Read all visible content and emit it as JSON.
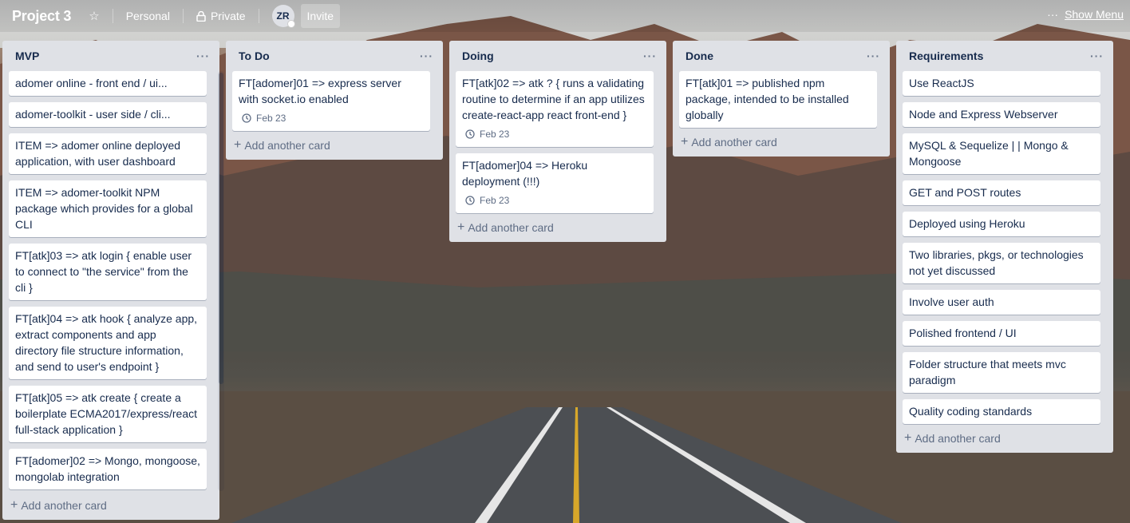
{
  "header": {
    "board_title": "Project 3",
    "star_icon": "star-icon",
    "team_label": "Personal",
    "visibility_label": "Private",
    "member_initials": "ZR",
    "invite_label": "Invite",
    "show_menu_label": "Show Menu"
  },
  "lists": [
    {
      "title": "MVP",
      "cards": [
        {
          "text": "adomer online - front end / ui..."
        },
        {
          "text": "adomer-toolkit - user side / cli..."
        },
        {
          "text": "ITEM => adomer online deployed application, with user dashboard"
        },
        {
          "text": "ITEM => adomer-toolkit NPM package which provides for a global CLI"
        },
        {
          "text": "FT[atk]03 => atk login { enable user to connect to \"the service\" from the cli }"
        },
        {
          "text": "FT[atk]04 => atk hook { analyze app, extract components and app directory file structure information, and send to user's endpoint }"
        },
        {
          "text": "FT[atk]05 => atk create { create a boilerplate ECMA2017/express/react full-stack application }"
        },
        {
          "text": "FT[adomer]02 => Mongo, mongoose, mongolab integration"
        }
      ],
      "add_label": "Add another card"
    },
    {
      "title": "To Do",
      "cards": [
        {
          "text": "FT[adomer]01 => express server with socket.io enabled",
          "date": "Feb 23"
        }
      ],
      "add_label": "Add another card"
    },
    {
      "title": "Doing",
      "cards": [
        {
          "text": "FT[atk]02 => atk ? { runs a validating routine to determine if an app utilizes create-react-app react front-end }",
          "date": "Feb 23"
        },
        {
          "text": "FT[adomer]04 => Heroku deployment (!!!)",
          "date": "Feb 23"
        }
      ],
      "add_label": "Add another card"
    },
    {
      "title": "Done",
      "cards": [
        {
          "text": "FT[atk]01 => published npm package, intended to be installed globally"
        }
      ],
      "add_label": "Add another card"
    },
    {
      "title": "Requirements",
      "cards": [
        {
          "text": "Use ReactJS"
        },
        {
          "text": "Node and Express Webserver"
        },
        {
          "text": "MySQL & Sequelize | | Mongo & Mongoose"
        },
        {
          "text": "GET and POST routes"
        },
        {
          "text": "Deployed using Heroku"
        },
        {
          "text": "Two libraries, pkgs, or technologies not yet discussed"
        },
        {
          "text": "Involve user auth"
        },
        {
          "text": "Polished frontend / UI"
        },
        {
          "text": "Folder structure that meets mvc paradigm"
        },
        {
          "text": "Quality coding standards"
        }
      ],
      "add_label": "Add another card"
    }
  ],
  "list_menu_glyph": "···",
  "add_glyph": "+",
  "icons": {
    "list_menu": "ellipsis-icon",
    "date": "clock-icon",
    "add": "plus-icon",
    "visibility": "lock-icon"
  }
}
